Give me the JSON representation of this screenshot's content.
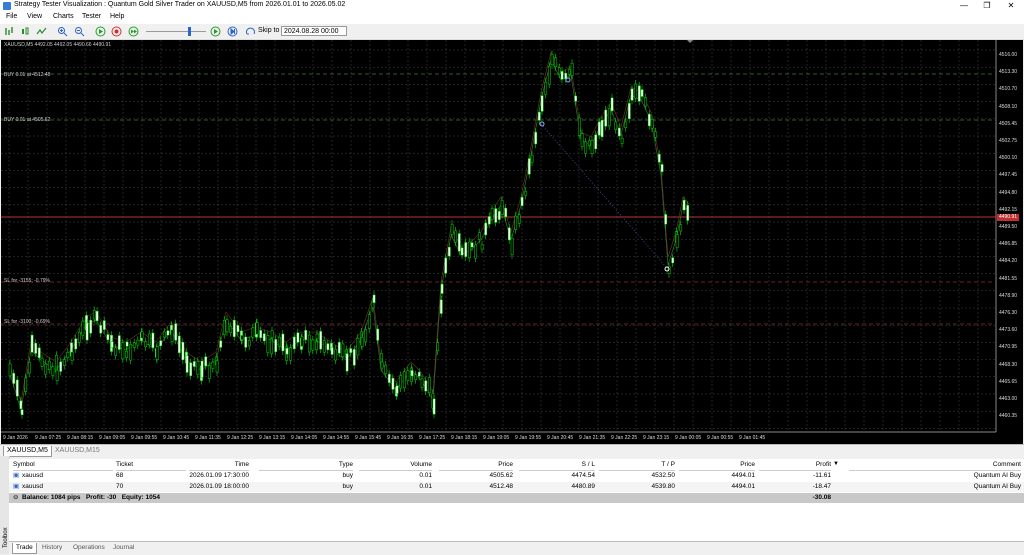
{
  "window": {
    "title": "Strategy Tester Visualization : Quantum Gold Silver Trader on XAUUSD,M5 from 2026.01.01 to 2026.05.02",
    "controls": [
      "—",
      "❐",
      "✕"
    ]
  },
  "menu": [
    "File",
    "View",
    "Charts",
    "Tester",
    "Help"
  ],
  "toolbar": {
    "skip_to_label": "Skip to",
    "skip_to_value": "2024.08.28 00:00"
  },
  "chart": {
    "header": "XAUUSD,M5  4492.05 4492.05 4490.66 4490.91",
    "current_price_label": "4490.91",
    "price_labels": [
      "4516.00",
      "4513.30",
      "4510.70",
      "4508.10",
      "4505.45",
      "4502.75",
      "4500.10",
      "4497.45",
      "4494.80",
      "4492.15",
      "4489.50",
      "4486.85",
      "4484.20",
      "4481.55",
      "4478.90",
      "4476.30",
      "4473.60",
      "4470.95",
      "4468.30",
      "4465.65",
      "4463.00",
      "4460.35"
    ],
    "time_labels": [
      "9 Jan 2026",
      "9 Jan 07:25",
      "9 Jan 08:15",
      "9 Jan 09:05",
      "9 Jan 09:55",
      "9 Jan 10:45",
      "9 Jan 11:35",
      "9 Jan 12:25",
      "9 Jan 13:15",
      "9 Jan 14:05",
      "9 Jan 14:55",
      "9 Jan 15:45",
      "9 Jan 16:35",
      "9 Jan 17:25",
      "9 Jan 18:15",
      "9 Jan 19:05",
      "9 Jan 19:55",
      "9 Jan 20:45",
      "9 Jan 21:35",
      "9 Jan 22:25",
      "9 Jan 23:15",
      "9 Jan 00:05",
      "9 Jan 00:55",
      "9 Jan 01:45"
    ],
    "order_labels": [
      "BUY 0.01 at 4512.48",
      "BUY 0.01 at 4505.62",
      "SL for -3155; -0.79%",
      "SL for -3100; -0.69%"
    ],
    "colors": {
      "background": "#000000",
      "bull_candle": "#ffffff",
      "bear_candle": "#000000",
      "candle_outline": "#00e000",
      "grid": "#444444",
      "price_line": "#c03030"
    }
  },
  "chart_tabs": [
    "XAUUSD,M5",
    "XAUUSD,M15"
  ],
  "table": {
    "headers": [
      "Symbol",
      "Ticket",
      "Time",
      "Type",
      "Volume",
      "Price",
      "S / L",
      "T / P",
      "Price",
      "Profit",
      "Comment"
    ],
    "rows": [
      [
        "xauusd",
        "68",
        "2026.01.09 17:30:00",
        "buy",
        "0.01",
        "4505.62",
        "4474.54",
        "4532.50",
        "4494.01",
        "-11.61",
        "Quantum AI Buy"
      ],
      [
        "xauusd",
        "70",
        "2026.01.09 18:00:00",
        "buy",
        "0.01",
        "4512.48",
        "4480.89",
        "4539.80",
        "4494.01",
        "-18.47",
        "Quantum AI Buy"
      ]
    ],
    "balance_text": "Balance: 1084 pips   Profit: -30   Equity: 1054",
    "total_profit": "-30.08"
  },
  "bottom_tabs": [
    "Trade",
    "History",
    "Operations",
    "Journal"
  ],
  "toolbox_label": "Toolbox"
}
